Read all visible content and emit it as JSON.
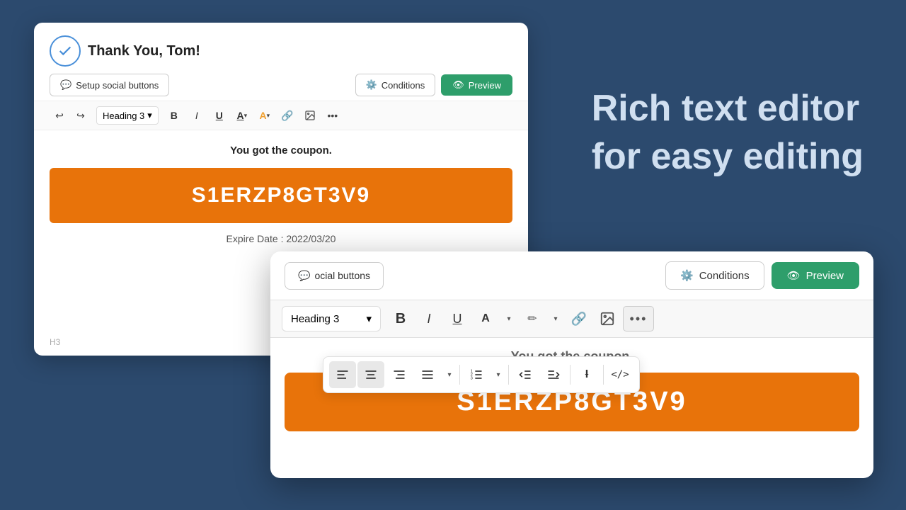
{
  "background": {
    "color": "#2c4a6e",
    "text_line1": "Rich text editor",
    "text_line2": "for easy editing"
  },
  "card1": {
    "thank_you": "Thank You, Tom!",
    "social_btn": "Setup social buttons",
    "conditions_btn": "Conditions",
    "preview_btn": "Preview",
    "heading_select": "Heading 3",
    "coupon_title": "You got the coupon.",
    "coupon_code": "S1ERZP8GT3V9",
    "expire_label": "Expire Date :",
    "expire_date": "2022/03/20",
    "footer_tag": "H3"
  },
  "card2": {
    "social_btn": "ocial buttons",
    "conditions_btn": "Conditions",
    "preview_btn": "Preview",
    "heading_select": "Heading 3",
    "coupon_title": "You got the coupon.",
    "coupon_code": "S1ERZP8GT3V9"
  }
}
